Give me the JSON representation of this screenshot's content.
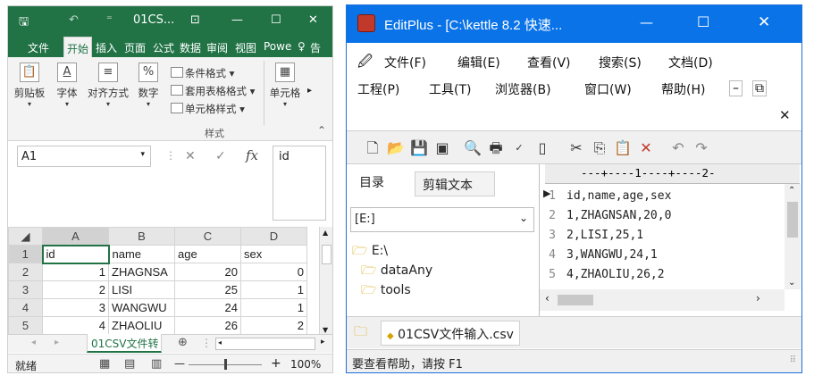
{
  "excel": {
    "title": "01CS...",
    "ribbon_tabs": [
      "文件",
      "开始",
      "插入",
      "页面",
      "公式",
      "数据",
      "审阅",
      "视图",
      "Powe",
      "告"
    ],
    "ribbon_groups": {
      "clipboard": "剪贴板",
      "font": "字体",
      "align": "对齐方式",
      "number": "数字",
      "cells": "单元格",
      "styles_label": "样式",
      "cond_format": "条件格式",
      "table_format": "套用表格格式",
      "cell_style": "单元格样式"
    },
    "name_box": "A1",
    "fx_symbol": "fx",
    "formula_value": "id",
    "columns": [
      "A",
      "B",
      "C",
      "D"
    ],
    "rows": [
      {
        "n": "1",
        "a": "id",
        "b": "name",
        "c": "age",
        "d": "sex"
      },
      {
        "n": "2",
        "a": "1",
        "b": "ZHAGNSA",
        "c": "20",
        "d": "0"
      },
      {
        "n": "3",
        "a": "2",
        "b": "LISI",
        "c": "25",
        "d": "1"
      },
      {
        "n": "4",
        "a": "3",
        "b": "WANGWU",
        "c": "24",
        "d": "1"
      },
      {
        "n": "5",
        "a": "4",
        "b": "ZHAOLIU",
        "c": "26",
        "d": "2"
      }
    ],
    "sheet_tab": "01CSV文件转",
    "status": "就绪",
    "zoom": "100%"
  },
  "editplus": {
    "title": "EditPlus - [C:\\kettle 8.2 快速...",
    "menu_row1": [
      "文件(F)",
      "编辑(E)",
      "查看(V)",
      "搜索(S)",
      "文档(D)"
    ],
    "menu_row2": [
      "工程(P)",
      "工具(T)",
      "浏览器(B)",
      "窗口(W)",
      "帮助(H)"
    ],
    "tabs": [
      "目录",
      "剪辑文本"
    ],
    "drive": "[E:]",
    "tree": [
      "E:\\",
      "dataAny",
      "tools"
    ],
    "ruler": "---+----1----+----2-",
    "lines": [
      {
        "n": "1",
        "text": "id,name,age,sex"
      },
      {
        "n": "2",
        "text": "1,ZHAGNSAN,20,0"
      },
      {
        "n": "3",
        "text": "2,LISI,25,1"
      },
      {
        "n": "4",
        "text": "3,WANGWU,24,1"
      },
      {
        "n": "5",
        "text": "4,ZHAOLIU,26,2"
      }
    ],
    "file_tab": "01CSV文件输入.csv",
    "status": "要查看帮助，请按 F1"
  },
  "colors": {
    "excel_green": "#217346",
    "editplus_blue": "#0a73e8"
  }
}
